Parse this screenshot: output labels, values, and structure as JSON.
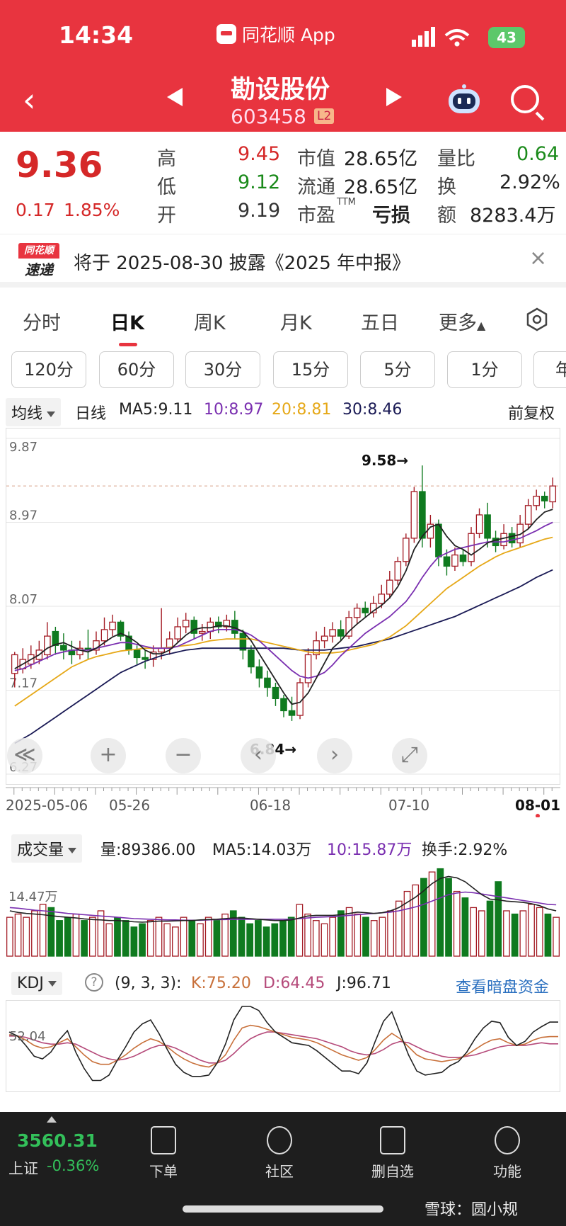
{
  "status": {
    "time": "14:34",
    "app": "同花顺 App",
    "battery": "43"
  },
  "header": {
    "stock_name": "勘设股份",
    "stock_code": "603458",
    "level": "L2"
  },
  "quote": {
    "price": "9.36",
    "change": "0.17",
    "change_pct": "1.85%",
    "high_label": "高",
    "high": "9.45",
    "low_label": "低",
    "low": "9.12",
    "open_label": "开",
    "open": "9.19",
    "mcap_label": "市值",
    "mcap": "28.65亿",
    "float_label": "流通",
    "float": "28.65亿",
    "pe_label": "市盈",
    "pe_sup": "TTM",
    "pe": "亏损",
    "vr_label": "量比",
    "vr": "0.64",
    "turn_label": "换",
    "turn": "2.92%",
    "amt_label": "额",
    "amt": "8283.4万"
  },
  "notice": {
    "badge_top": "同花顺",
    "badge_bottom": "速递",
    "text": "将于 2025-08-30 披露《2025 年中报》",
    "close": "×"
  },
  "tabs": [
    "分时",
    "日K",
    "周K",
    "月K",
    "五日",
    "更多"
  ],
  "periods": [
    "120分",
    "60分",
    "30分",
    "15分",
    "5分",
    "1分",
    "年"
  ],
  "ma": {
    "selector": "均线",
    "line_type": "日线",
    "ma5": "MA5:9.11",
    "ma10": "10:8.97",
    "ma20": "20:8.81",
    "ma30": "30:8.46",
    "adjust": "前复权"
  },
  "colors": {
    "up": "#a31b24",
    "down": "#0f7a1f",
    "ma5": "#222222",
    "ma10": "#7a2fb0",
    "ma20": "#e6a817",
    "ma30": "#1a1a55",
    "kdj_k": "#c8703a",
    "kdj_d": "#b54a7a",
    "kdj_j": "#222222",
    "header": "#e8343f"
  },
  "chart_data": [
    {
      "type": "candlestick",
      "title": "",
      "y_ticks": [
        "9.87",
        "8.97",
        "8.07",
        "7.17",
        "6.27"
      ],
      "ylim": [
        6.27,
        9.87
      ],
      "x_labels": [
        "2025-05-06",
        "05-26",
        "06-18",
        "07-10",
        "08-01"
      ],
      "annotations": {
        "high": "9.58→",
        "low": "6.84→"
      },
      "candles": [
        [
          7.35,
          7.55,
          7.2,
          7.58
        ],
        [
          7.4,
          7.5,
          7.35,
          7.62
        ],
        [
          7.45,
          7.55,
          7.4,
          7.65
        ],
        [
          7.5,
          7.6,
          7.45,
          7.7
        ],
        [
          7.55,
          7.75,
          7.5,
          7.9
        ],
        [
          7.8,
          7.65,
          7.55,
          7.85
        ],
        [
          7.65,
          7.6,
          7.5,
          7.78
        ],
        [
          7.6,
          7.55,
          7.45,
          7.7
        ],
        [
          7.55,
          7.62,
          7.5,
          7.7
        ],
        [
          7.62,
          7.6,
          7.5,
          7.82
        ],
        [
          7.6,
          7.7,
          7.55,
          7.8
        ],
        [
          7.7,
          7.82,
          7.65,
          7.95
        ],
        [
          7.82,
          7.9,
          7.75,
          7.98
        ],
        [
          7.9,
          7.75,
          7.7,
          7.92
        ],
        [
          7.75,
          7.6,
          7.55,
          7.8
        ],
        [
          7.6,
          7.52,
          7.45,
          7.65
        ],
        [
          7.52,
          7.5,
          7.4,
          7.6
        ],
        [
          7.5,
          7.58,
          7.42,
          7.65
        ],
        [
          7.58,
          7.62,
          7.5,
          8.05
        ],
        [
          7.62,
          7.72,
          7.55,
          7.8
        ],
        [
          7.72,
          7.85,
          7.68,
          7.95
        ],
        [
          7.85,
          7.92,
          7.78,
          8.0
        ],
        [
          7.92,
          7.78,
          7.72,
          7.96
        ],
        [
          7.78,
          7.8,
          7.7,
          7.88
        ],
        [
          7.8,
          7.9,
          7.72,
          7.95
        ],
        [
          7.9,
          7.85,
          7.78,
          7.96
        ],
        [
          7.85,
          7.92,
          7.8,
          7.98
        ],
        [
          7.92,
          7.78,
          7.72,
          8.02
        ],
        [
          7.78,
          7.6,
          7.5,
          7.82
        ],
        [
          7.6,
          7.42,
          7.35,
          7.65
        ],
        [
          7.42,
          7.3,
          7.2,
          7.5
        ],
        [
          7.3,
          7.2,
          7.1,
          7.38
        ],
        [
          7.2,
          7.08,
          7.0,
          7.25
        ],
        [
          7.08,
          6.95,
          6.88,
          7.12
        ],
        [
          6.95,
          6.9,
          6.84,
          7.1
        ],
        [
          6.9,
          7.25,
          6.86,
          7.3
        ],
        [
          7.25,
          7.55,
          7.2,
          7.62
        ],
        [
          7.55,
          7.7,
          7.5,
          7.8
        ],
        [
          7.7,
          7.75,
          7.62,
          7.85
        ],
        [
          7.75,
          7.82,
          7.68,
          7.9
        ],
        [
          7.82,
          7.75,
          7.7,
          7.92
        ],
        [
          7.75,
          7.95,
          7.72,
          8.02
        ],
        [
          7.95,
          8.05,
          7.88,
          8.1
        ],
        [
          8.05,
          8.0,
          7.95,
          8.12
        ],
        [
          8.0,
          8.1,
          7.95,
          8.18
        ],
        [
          8.1,
          8.2,
          8.05,
          8.3
        ],
        [
          8.2,
          8.35,
          8.15,
          8.45
        ],
        [
          8.35,
          8.55,
          8.3,
          8.6
        ],
        [
          8.55,
          8.8,
          8.5,
          8.85
        ],
        [
          8.8,
          9.3,
          8.75,
          9.35
        ],
        [
          9.3,
          8.8,
          8.7,
          9.58
        ],
        [
          8.8,
          8.95,
          8.7,
          9.05
        ],
        [
          8.95,
          8.6,
          8.5,
          9.0
        ],
        [
          8.6,
          8.5,
          8.4,
          8.68
        ],
        [
          8.5,
          8.62,
          8.45,
          8.7
        ],
        [
          8.62,
          8.55,
          8.5,
          8.68
        ],
        [
          8.55,
          8.85,
          8.5,
          8.92
        ],
        [
          8.85,
          9.05,
          8.8,
          9.12
        ],
        [
          9.05,
          8.8,
          8.7,
          9.18
        ],
        [
          8.8,
          8.72,
          8.65,
          8.88
        ],
        [
          8.72,
          8.85,
          8.68,
          8.95
        ],
        [
          8.85,
          8.75,
          8.7,
          8.92
        ],
        [
          8.75,
          8.95,
          8.7,
          9.05
        ],
        [
          8.95,
          9.15,
          8.9,
          9.22
        ],
        [
          9.15,
          9.25,
          9.1,
          9.32
        ],
        [
          9.25,
          9.2,
          9.12,
          9.3
        ],
        [
          9.19,
          9.36,
          9.12,
          9.45
        ]
      ],
      "ma5": [
        7.4,
        7.45,
        7.5,
        7.55,
        7.62,
        7.66,
        7.68,
        7.64,
        7.6,
        7.58,
        7.62,
        7.68,
        7.74,
        7.78,
        7.74,
        7.68,
        7.6,
        7.56,
        7.56,
        7.6,
        7.68,
        7.76,
        7.82,
        7.84,
        7.84,
        7.86,
        7.86,
        7.84,
        7.8,
        7.7,
        7.56,
        7.42,
        7.28,
        7.14,
        7.02,
        7.04,
        7.14,
        7.3,
        7.46,
        7.62,
        7.7,
        7.8,
        7.88,
        7.95,
        8.02,
        8.08,
        8.16,
        8.28,
        8.45,
        8.68,
        8.82,
        8.92,
        8.95,
        8.82,
        8.72,
        8.68,
        8.62,
        8.68,
        8.75,
        8.78,
        8.8,
        8.82,
        8.84,
        8.9,
        9.0,
        9.08,
        9.11
      ],
      "ma10": [
        7.38,
        7.4,
        7.44,
        7.48,
        7.52,
        7.56,
        7.58,
        7.6,
        7.6,
        7.6,
        7.62,
        7.64,
        7.66,
        7.68,
        7.68,
        7.66,
        7.64,
        7.62,
        7.62,
        7.62,
        7.64,
        7.68,
        7.72,
        7.76,
        7.8,
        7.82,
        7.82,
        7.82,
        7.8,
        7.76,
        7.7,
        7.62,
        7.54,
        7.46,
        7.38,
        7.32,
        7.3,
        7.32,
        7.36,
        7.44,
        7.54,
        7.62,
        7.7,
        7.78,
        7.84,
        7.9,
        7.96,
        8.04,
        8.12,
        8.24,
        8.38,
        8.5,
        8.6,
        8.64,
        8.68,
        8.7,
        8.72,
        8.74,
        8.76,
        8.76,
        8.76,
        8.78,
        8.8,
        8.84,
        8.88,
        8.93,
        8.97
      ],
      "ma20": [
        7.0,
        7.06,
        7.12,
        7.18,
        7.24,
        7.3,
        7.36,
        7.42,
        7.46,
        7.5,
        7.53,
        7.55,
        7.57,
        7.59,
        7.6,
        7.61,
        7.62,
        7.62,
        7.62,
        7.63,
        7.64,
        7.65,
        7.66,
        7.68,
        7.7,
        7.71,
        7.72,
        7.72,
        7.72,
        7.72,
        7.7,
        7.68,
        7.66,
        7.64,
        7.62,
        7.6,
        7.58,
        7.57,
        7.57,
        7.57,
        7.58,
        7.6,
        7.62,
        7.64,
        7.66,
        7.7,
        7.74,
        7.8,
        7.86,
        7.94,
        8.02,
        8.1,
        8.18,
        8.26,
        8.32,
        8.38,
        8.44,
        8.5,
        8.55,
        8.6,
        8.64,
        8.67,
        8.7,
        8.73,
        8.76,
        8.79,
        8.81
      ],
      "ma30": [
        6.6,
        6.65,
        6.7,
        6.76,
        6.82,
        6.88,
        6.94,
        7.0,
        7.06,
        7.12,
        7.18,
        7.24,
        7.3,
        7.36,
        7.4,
        7.44,
        7.48,
        7.51,
        7.54,
        7.56,
        7.58,
        7.6,
        7.61,
        7.62,
        7.62,
        7.62,
        7.62,
        7.62,
        7.62,
        7.62,
        7.62,
        7.62,
        7.62,
        7.62,
        7.61,
        7.6,
        7.6,
        7.6,
        7.6,
        7.61,
        7.62,
        7.63,
        7.64,
        7.66,
        7.68,
        7.7,
        7.72,
        7.75,
        7.78,
        7.81,
        7.84,
        7.87,
        7.9,
        7.93,
        7.96,
        8.0,
        8.04,
        8.08,
        8.12,
        8.16,
        8.2,
        8.24,
        8.28,
        8.33,
        8.38,
        8.42,
        8.46
      ]
    },
    {
      "type": "bar",
      "title": "",
      "selector": "成交量",
      "vol_label": "量:89386.00",
      "ma5_label": "MA5:14.03万",
      "ma10_label": "10:15.87万",
      "turnover_label": "换手:2.92%",
      "y_tick": "14.47万",
      "values": [
        12,
        13,
        12,
        14,
        16,
        15,
        11,
        12,
        13,
        11,
        12,
        14,
        10,
        12,
        11,
        9,
        10,
        11,
        12,
        10,
        9,
        12,
        11,
        10,
        12,
        11,
        13,
        14,
        12,
        10,
        11,
        9,
        10,
        11,
        12,
        16,
        13,
        11,
        10,
        12,
        14,
        15,
        13,
        12,
        11,
        12,
        14,
        17,
        20,
        22,
        24,
        26,
        27,
        24,
        20,
        18,
        15,
        14,
        17,
        23,
        14,
        13,
        14,
        16,
        15,
        13,
        12
      ],
      "ma5": [
        14,
        13.5,
        13.2,
        13,
        12.8,
        12.5,
        12.2,
        12,
        11.8,
        11.5,
        11.3,
        11.2,
        11,
        11,
        10.8,
        10.6,
        10.5,
        10.6,
        10.8,
        10.8,
        10.9,
        11,
        11,
        11.2,
        11.3,
        11.4,
        11.6,
        11.8,
        11.8,
        11.6,
        11.4,
        11.2,
        11,
        11,
        11.2,
        11.8,
        12.4,
        12.6,
        12.6,
        12.6,
        12.8,
        13.2,
        13.6,
        13.4,
        13.2,
        13.4,
        14,
        15,
        16.6,
        18.2,
        20.2,
        22.4,
        24,
        24.6,
        24.2,
        23,
        21,
        19,
        17.6,
        17.4,
        17,
        16.8,
        16.6,
        16.2,
        15.6,
        14.6,
        14
      ],
      "ma10": [
        15,
        14.8,
        14.5,
        14.2,
        14,
        13.8,
        13.5,
        13.2,
        13,
        12.8,
        12.6,
        12.4,
        12.2,
        12,
        11.8,
        11.6,
        11.5,
        11.4,
        11.3,
        11.2,
        11.2,
        11.1,
        11.1,
        11.1,
        11.2,
        11.3,
        11.3,
        11.4,
        11.4,
        11.4,
        11.4,
        11.4,
        11.4,
        11.4,
        11.4,
        11.6,
        11.8,
        12,
        12.1,
        12.2,
        12.4,
        12.6,
        12.8,
        13,
        13.2,
        13.4,
        13.6,
        14,
        14.6,
        15.2,
        16,
        17,
        18,
        19,
        19.5,
        19.8,
        19.6,
        19.2,
        18.8,
        18.4,
        18,
        17.6,
        17.2,
        16.8,
        16.4,
        16,
        15.87
      ]
    },
    {
      "type": "line",
      "title": "",
      "selector": "KDJ",
      "params": "(9, 3, 3):",
      "k_label": "K:75.20",
      "d_label": "D:64.45",
      "j_label": "J:96.71",
      "y_tick": "52.04",
      "link": "查看暗盘资金",
      "K": [
        78,
        76,
        70,
        62,
        58,
        60,
        66,
        72,
        60,
        48,
        38,
        34,
        34,
        40,
        48,
        58,
        66,
        72,
        68,
        60,
        50,
        42,
        36,
        32,
        30,
        36,
        48,
        70,
        88,
        92,
        90,
        86,
        82,
        78,
        74,
        72,
        70,
        66,
        60,
        54,
        48,
        44,
        40,
        44,
        56,
        70,
        80,
        72,
        60,
        48,
        42,
        40,
        38,
        40,
        42,
        48,
        56,
        64,
        70,
        72,
        66,
        62,
        64,
        70,
        74,
        75.2,
        75.2
      ],
      "D": [
        76,
        76,
        74,
        70,
        66,
        64,
        64,
        66,
        64,
        58,
        52,
        46,
        42,
        40,
        42,
        46,
        52,
        58,
        62,
        62,
        58,
        52,
        46,
        40,
        36,
        36,
        40,
        50,
        62,
        72,
        78,
        82,
        82,
        80,
        78,
        76,
        74,
        72,
        68,
        64,
        60,
        54,
        50,
        48,
        50,
        56,
        64,
        68,
        66,
        60,
        54,
        50,
        46,
        44,
        44,
        46,
        48,
        52,
        56,
        60,
        62,
        62,
        62,
        64,
        66,
        64.45,
        64.45
      ],
      "J": [
        82,
        76,
        62,
        46,
        42,
        52,
        70,
        84,
        52,
        28,
        10,
        10,
        18,
        40,
        60,
        82,
        94,
        100,
        80,
        56,
        34,
        22,
        16,
        16,
        18,
        36,
        64,
        100,
        120,
        120,
        114,
        96,
        82,
        74,
        66,
        64,
        62,
        54,
        44,
        34,
        24,
        24,
        20,
        36,
        68,
        98,
        112,
        80,
        48,
        24,
        18,
        20,
        22,
        32,
        38,
        52,
        72,
        88,
        98,
        96,
        74,
        62,
        68,
        82,
        90,
        96.71,
        96.71
      ]
    }
  ],
  "controls": {
    "collapse": "≪",
    "zoom_in": "+",
    "zoom_out": "−",
    "prev": "‹",
    "next": "›",
    "fullscreen": "⤢"
  },
  "bottom_nav": {
    "index_value": "3560.31",
    "index_name": "上证",
    "index_change": "-0.36%",
    "order": "下单",
    "community": "社区",
    "delete": "删自选",
    "function": "功能"
  },
  "watermark": "雪球：圆小规"
}
